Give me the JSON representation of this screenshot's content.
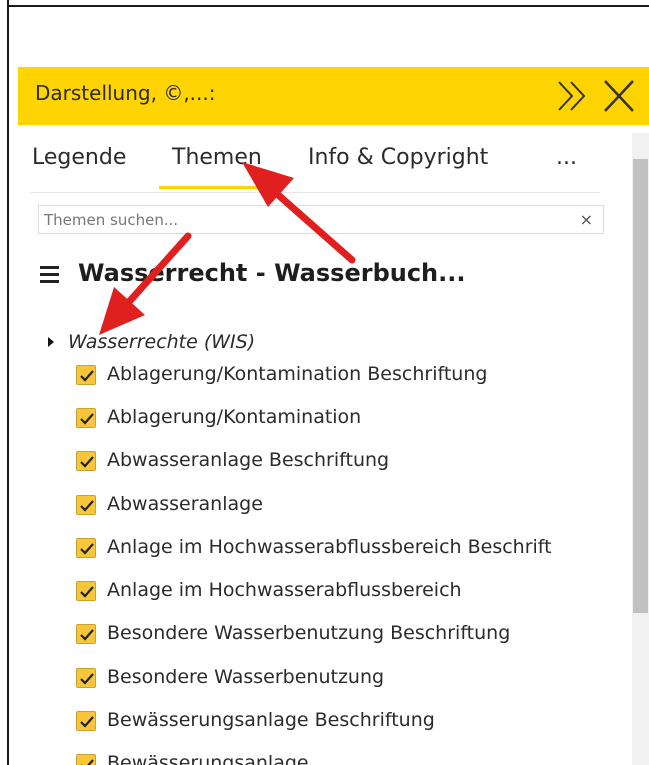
{
  "colors": {
    "accent": "#ffd400",
    "checkbox": "#f7c63b",
    "annotation_arrow": "#e0201e"
  },
  "header": {
    "title": "Darstellung, ©,...:",
    "collapse_icon": "double-chevron-right-icon",
    "close_icon": "close-icon"
  },
  "tabs": [
    {
      "label": "Legende",
      "active": false
    },
    {
      "label": "Themen",
      "active": true
    },
    {
      "label": "Info & Copyright",
      "active": false
    },
    {
      "label": "...",
      "active": false
    }
  ],
  "search": {
    "placeholder": "Themen suchen...",
    "value": "",
    "clear_label": "×"
  },
  "theme": {
    "title": "Wasserrecht - Wasserbuch..."
  },
  "group": {
    "label": "Wasserrechte (WIS)",
    "expanded": true
  },
  "layers": [
    {
      "label": "Ablagerung/Kontamination Beschriftung",
      "checked": true
    },
    {
      "label": "Ablagerung/Kontamination",
      "checked": true
    },
    {
      "label": "Abwasseranlage Beschriftung",
      "checked": true
    },
    {
      "label": "Abwasseranlage",
      "checked": true
    },
    {
      "label": "Anlage im Hochwasserabflussbereich Beschrift",
      "checked": true
    },
    {
      "label": "Anlage im Hochwasserabflussbereich",
      "checked": true
    },
    {
      "label": "Besondere Wasserbenutzung Beschriftung",
      "checked": true
    },
    {
      "label": "Besondere Wasserbenutzung",
      "checked": true
    },
    {
      "label": "Bewässerungsanlage Beschriftung",
      "checked": true
    },
    {
      "label": "Bewässerungsanlage",
      "checked": true
    }
  ]
}
